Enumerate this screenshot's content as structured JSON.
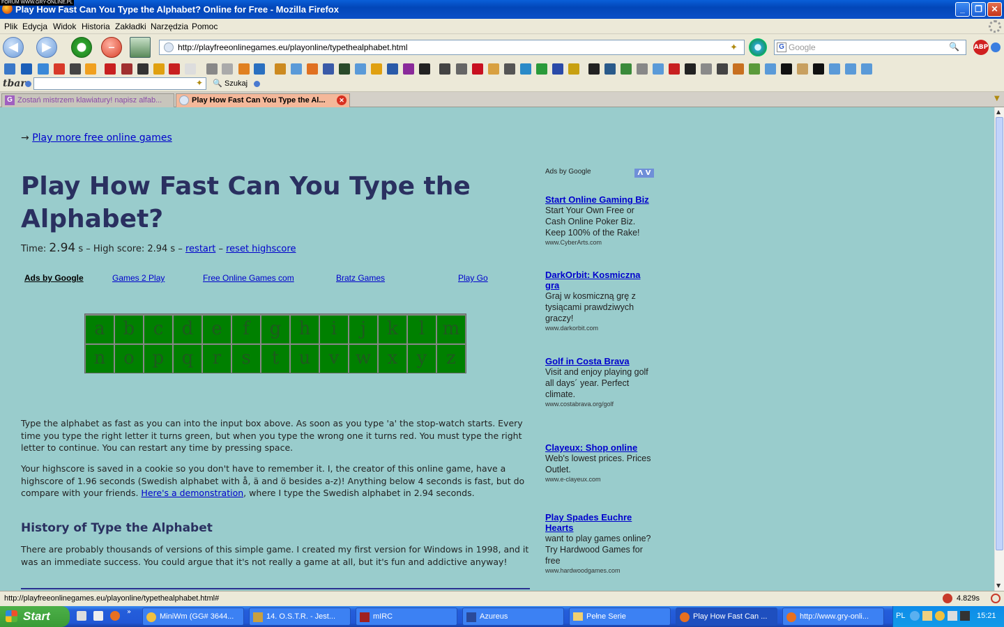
{
  "window": {
    "watermark": "FORUM WWW.GRY-ONLINE.PL",
    "title": "Play How Fast Can You Type the Alphabet? Online for Free - Mozilla Firefox"
  },
  "menu": [
    "Plik",
    "Edycja",
    "Widok",
    "Historia",
    "Zakładki",
    "Narzędzia",
    "Pomoc"
  ],
  "navbar": {
    "url": "http://playfreeonlinegames.eu/playonline/typethealphabet.html",
    "search_placeholder": "Google"
  },
  "tbar": {
    "logo": "tbar",
    "search_label": "Szukaj"
  },
  "tabs": [
    {
      "label": "Zostań mistrzem klawiatury! napisz alfab...",
      "active": false
    },
    {
      "label": "Play How Fast Can You Type the Al...",
      "active": true
    }
  ],
  "page": {
    "more_games_arrow": "→",
    "more_games_link": "Play more free online games",
    "title": "Play How Fast Can You Type the Alphabet?",
    "time_label": "Time:",
    "time_value": "2.94",
    "time_unit": "s",
    "highscore_text": "– High score: 2.94 s –",
    "restart": "restart",
    "dash": "–",
    "reset_highscore": "reset highscore",
    "ad_links": [
      "Ads by Google",
      "Games 2 Play",
      "Free Online Games com",
      "Bratz Games",
      "Play Go"
    ],
    "letters": [
      "a",
      "b",
      "c",
      "d",
      "e",
      "f",
      "g",
      "h",
      "i",
      "j",
      "k",
      "l",
      "m",
      "n",
      "o",
      "p",
      "q",
      "r",
      "s",
      "t",
      "u",
      "v",
      "w",
      "x",
      "y",
      "z"
    ],
    "para1": "Type the alphabet as fast as you can into the input box above. As soon as you type 'a' the stop-watch starts. Every time you type the right letter it turns green, but when you type the wrong one it turns red. You must type the right letter to continue. You can restart any time by pressing space.",
    "para2_before": "Your highscore is saved in a cookie so you don't have to remember it. I, the creator of this online game, have a highscore of 1.96 seconds (Swedish alphabet with å, ä and ö besides a-z)! Anything below 4 seconds is fast, but do compare with your friends. ",
    "para2_link": "Here's a demonstration",
    "para2_after": ", where I type the Swedish alphabet in 2.94 seconds.",
    "history_heading": "History of Type the Alphabet",
    "para3": "There are probably thousands of versions of this simple game. I created my first version for Windows in 1998, and it was an immediate success. You could argue that it's not really a game at all, but it's fun and addictive anyway!"
  },
  "sidebar_ads": {
    "header": "Ads by Google",
    "header_arrows": "Λ V",
    "items": [
      {
        "title": "Start Online Gaming Biz",
        "desc": "Start Your Own Free or Cash Online Poker Biz. Keep 100% of the Rake!",
        "url": "www.CyberArts.com"
      },
      {
        "title": "DarkOrbit: Kosmiczna gra",
        "desc": "Graj w kosmiczną grę z tysiącami prawdziwych graczy!",
        "url": "www.darkorbit.com"
      },
      {
        "title": "Golf in Costa Brava",
        "desc": "Visit and enjoy playing golf all days´ year. Perfect climate.",
        "url": "www.costabrava.org/golf"
      },
      {
        "title": "Clayeux: Shop online",
        "desc": "Web's lowest prices. Prices Outlet.",
        "url": "www.e-clayeux.com"
      },
      {
        "title": "Play Spades Euchre Hearts",
        "desc": "want to play games online? Try Hardwood Games for free",
        "url": "www.hardwoodgames.com"
      }
    ]
  },
  "status": {
    "url": "http://playfreeonlinegames.eu/playonline/typethealphabet.html#",
    "timing": "4.829s"
  },
  "taskbar": {
    "start": "Start",
    "tasks": [
      {
        "label": "MiniWm (GG# 3644...",
        "active": false
      },
      {
        "label": "14. O.S.T.R. - Jest...",
        "active": false
      },
      {
        "label": "mIRC",
        "active": false
      },
      {
        "label": "Azureus",
        "active": false
      },
      {
        "label": "Pełne Serie",
        "active": false
      },
      {
        "label": "Play How Fast Can ...",
        "active": true
      },
      {
        "label": "http://www.gry-onli...",
        "active": false
      }
    ],
    "lang": "PL",
    "clock": "15:21"
  }
}
